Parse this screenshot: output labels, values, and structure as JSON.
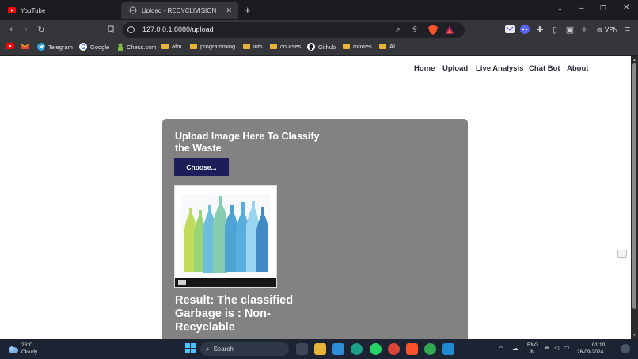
{
  "browser": {
    "tabs": [
      {
        "title": "YouTube",
        "active": false
      },
      {
        "title": "Upload - RECYCLIVISION",
        "active": true
      }
    ],
    "new_tab": "+",
    "url": "127.0.0.1:8080/upload",
    "vpn_label": "VPN",
    "bookmarks": [
      "Telegram",
      "Google",
      "Chess.com",
      "afm",
      "programming",
      "ints",
      "courses",
      "Github",
      "movies",
      "AI"
    ]
  },
  "site": {
    "nav": [
      "Home",
      "Upload",
      "Live Analysis",
      "Chat Bot",
      "About"
    ],
    "upload_title": "Upload Image Here To Classify the Waste",
    "choose_label": "Choose...",
    "result_text": "Result: The classified Garbage is : Non-Recyclable"
  },
  "taskbar": {
    "weather_temp": "26°C",
    "weather_desc": "Cloudy",
    "search_placeholder": "Search",
    "lang_line1": "ENG",
    "lang_line2": "IN",
    "time": "01:10",
    "date": "26-09-2024"
  },
  "colors": {
    "card": "#828282",
    "button": "#1f1c5a",
    "tabbar": "#1b1c1f",
    "toolbar": "#35363a",
    "taskbar": "#1c2433"
  }
}
